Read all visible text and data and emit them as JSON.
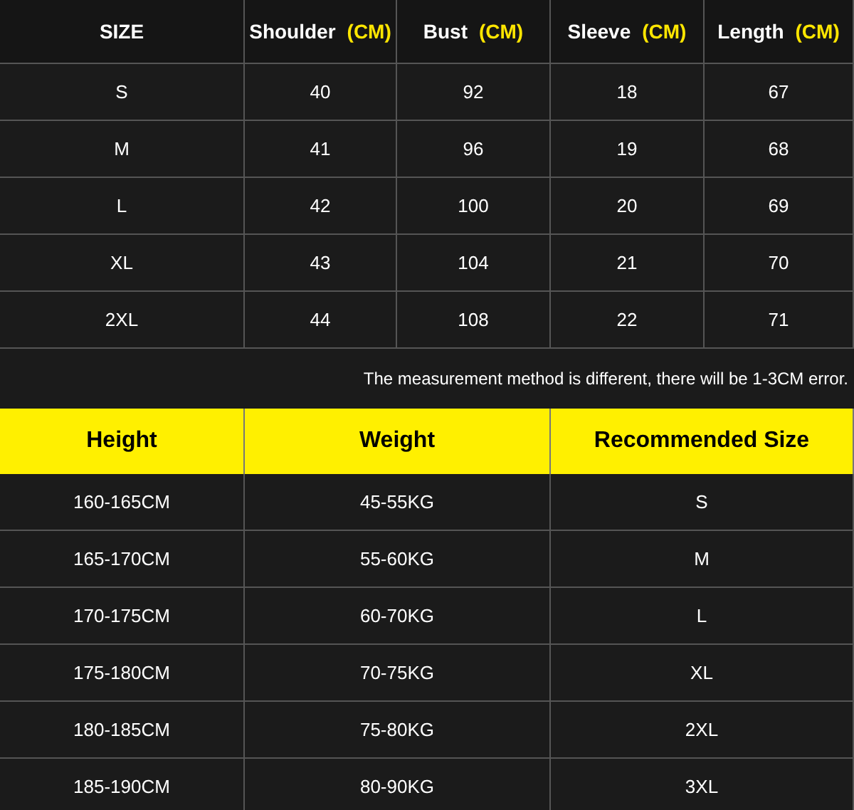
{
  "measurements": {
    "columns": [
      {
        "label": "SIZE"
      },
      {
        "label": "Shoulder",
        "unit": "(CM)"
      },
      {
        "label": "Bust",
        "unit": "(CM)"
      },
      {
        "label": "Sleeve",
        "unit": "(CM)"
      },
      {
        "label": "Length",
        "unit": "(CM)"
      }
    ],
    "rows": [
      [
        "S",
        "40",
        "92",
        "18",
        "67"
      ],
      [
        "M",
        "41",
        "96",
        "19",
        "68"
      ],
      [
        "L",
        "42",
        "100",
        "20",
        "69"
      ],
      [
        "XL",
        "43",
        "104",
        "21",
        "70"
      ],
      [
        "2XL",
        "44",
        "108",
        "22",
        "71"
      ]
    ]
  },
  "note": "The measurement method is different, there will be 1-3CM error.",
  "recommendations": {
    "columns": [
      "Height",
      "Weight",
      "Recommended Size"
    ],
    "rows": [
      [
        "160-165CM",
        "45-55KG",
        "S"
      ],
      [
        "165-170CM",
        "55-60KG",
        "M"
      ],
      [
        "170-175CM",
        "60-70KG",
        "L"
      ],
      [
        "175-180CM",
        "70-75KG",
        "XL"
      ],
      [
        "180-185CM",
        "75-80KG",
        "2XL"
      ],
      [
        "185-190CM",
        "80-90KG",
        "3XL"
      ]
    ]
  }
}
